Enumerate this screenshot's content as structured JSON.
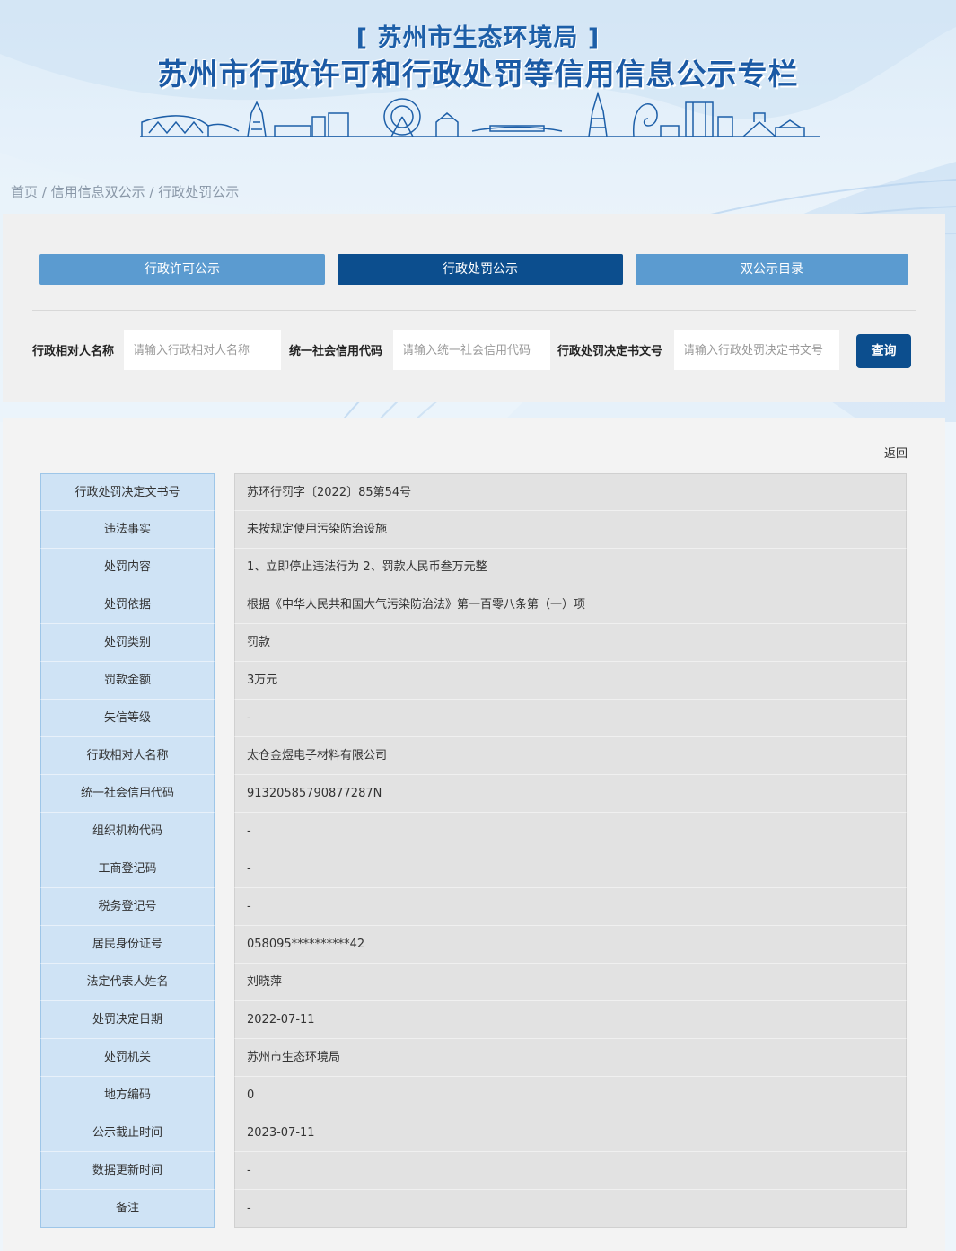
{
  "header": {
    "subtitle": "[ 苏州市生态环境局 ]",
    "title": "苏州市行政许可和行政处罚等信用信息公示专栏"
  },
  "breadcrumb": {
    "home": "首页",
    "sep": " / ",
    "section": "信用信息双公示",
    "current": "行政处罚公示"
  },
  "tabs": [
    {
      "label": "行政许可公示",
      "active": false
    },
    {
      "label": "行政处罚公示",
      "active": true
    },
    {
      "label": "双公示目录",
      "active": false
    }
  ],
  "search": {
    "name_label": "行政相对人名称",
    "name_placeholder": "请输入行政相对人名称",
    "code_label": "统一社会信用代码",
    "code_placeholder": "请输入统一社会信用代码",
    "doc_label": "行政处罚决定书文号",
    "doc_placeholder": "请输入行政处罚决定书文号",
    "query_label": "查询"
  },
  "back_label": "返回",
  "details": [
    {
      "key": "行政处罚决定文书号",
      "value": "苏环行罚字〔2022〕85第54号"
    },
    {
      "key": "违法事实",
      "value": "未按规定使用污染防治设施"
    },
    {
      "key": "处罚内容",
      "value": "1、立即停止违法行为 2、罚款人民币叁万元整"
    },
    {
      "key": "处罚依据",
      "value": "根据《中华人民共和国大气污染防治法》第一百零八条第（一）项"
    },
    {
      "key": "处罚类别",
      "value": "罚款"
    },
    {
      "key": "罚款金额",
      "value": "3万元"
    },
    {
      "key": "失信等级",
      "value": "-"
    },
    {
      "key": "行政相对人名称",
      "value": "太仓金煜电子材料有限公司"
    },
    {
      "key": "统一社会信用代码",
      "value": "91320585790877287N"
    },
    {
      "key": "组织机构代码",
      "value": "-"
    },
    {
      "key": "工商登记码",
      "value": "-"
    },
    {
      "key": "税务登记号",
      "value": "-"
    },
    {
      "key": "居民身份证号",
      "value": "058095**********42"
    },
    {
      "key": "法定代表人姓名",
      "value": "刘晓萍"
    },
    {
      "key": "处罚决定日期",
      "value": "2022-07-11"
    },
    {
      "key": "处罚机关",
      "value": "苏州市生态环境局"
    },
    {
      "key": "地方编码",
      "value": "0"
    },
    {
      "key": "公示截止时间",
      "value": "2023-07-11"
    },
    {
      "key": "数据更新时间",
      "value": "-"
    },
    {
      "key": "备注",
      "value": "-"
    }
  ]
}
